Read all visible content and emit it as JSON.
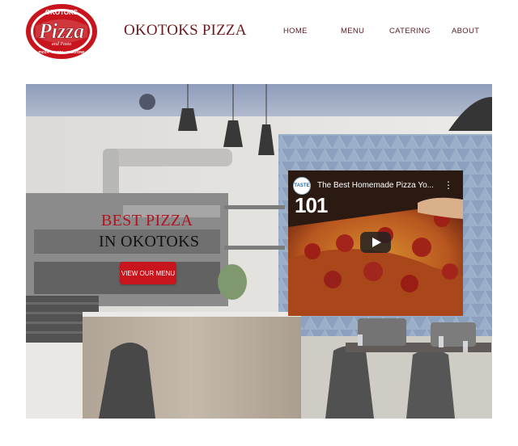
{
  "header": {
    "logo": {
      "top_text": "OKOTOKS",
      "main_text": "Pizza",
      "sub_text": "and Pasta",
      "tagline": "PIZZA · PASTA · CALZONE"
    },
    "site_title": "OKOTOKS PIZZA",
    "nav": [
      {
        "label": "HOME"
      },
      {
        "label": "MENU"
      },
      {
        "label": "CATERING"
      },
      {
        "label": "ABOUT"
      }
    ]
  },
  "hero": {
    "headline_1": "BEST PIZZA",
    "headline_2": "IN OKOTOKS",
    "cta_label": "VIEW OUR MENU",
    "video": {
      "title": "The Best Homemade Pizza Yo...",
      "channel_badge": "TASTE",
      "badge_text": "101",
      "more_icon": "⋮"
    }
  },
  "colors": {
    "brand_red": "#c8141c",
    "title_maroon": "#6b1a1f",
    "headline_red": "#b3121f"
  }
}
